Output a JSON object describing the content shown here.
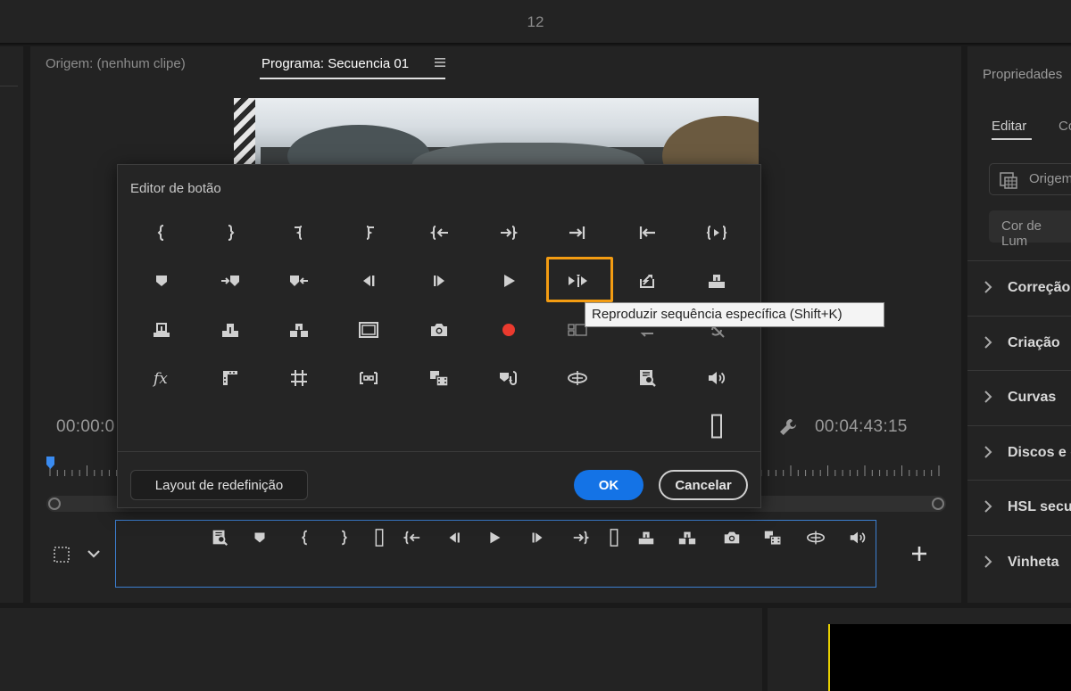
{
  "topbar": {
    "workspace_number": "12"
  },
  "program_monitor": {
    "source_tab": "Origem: (nenhum clipe)",
    "program_tab": "Programa: Secuencia 01",
    "timecode_left": "00:00:0",
    "timecode_right": "00:04:43:15"
  },
  "properties_panel": {
    "title": "Propriedades",
    "tabs": [
      "Editar",
      "Co"
    ],
    "origin_label": "Origem",
    "luma_label": "Cor de Lum",
    "sections": [
      "Correção",
      "Criação",
      "Curvas",
      "Discos e c",
      "HSL secu",
      "Vinheta"
    ]
  },
  "button_editor": {
    "title": "Editor de botão",
    "rows": [
      [
        "mark-in-icon",
        "mark-out-icon",
        "clear-in-icon",
        "clear-out-icon",
        "go-to-in-icon",
        "go-to-out-icon",
        "go-to-next-edit-icon",
        "go-to-previous-edit-icon",
        "play-in-to-out-icon"
      ],
      [
        "add-marker-icon",
        "go-to-next-marker-icon",
        "go-to-previous-marker-icon",
        "step-back-icon",
        "step-forward-icon",
        "play-icon",
        "play-around-icon",
        "export-frame-alt-icon",
        "lift-icon"
      ],
      [
        "overwrite-icon",
        "insert-icon",
        "extract-icon",
        "safe-margins-icon",
        "export-frame-icon",
        "record-icon",
        "multi-camera-icon",
        "loop-icon",
        "comparison-view-icon"
      ],
      [
        "fx-icon",
        "proxy-icon",
        "grid-icon",
        "trim-icon",
        "insert-clip-icon",
        "replace-icon",
        "vr-icon",
        "zoom-search-icon",
        "volume-icon"
      ]
    ],
    "extra_item": "spacer-icon",
    "tooltip": "Reproduzir sequência específica (Shift+K)",
    "reset_label": "Layout de redefinição",
    "ok_label": "OK",
    "cancel_label": "Cancelar"
  },
  "transport_bar": {
    "buttons": [
      "zoom-search-icon",
      "add-marker-icon",
      "mark-in-icon",
      "mark-out-icon",
      "spacer-icon",
      "go-to-in-icon",
      "step-back-icon",
      "play-icon",
      "step-forward-icon",
      "go-to-out-icon",
      "spacer-icon",
      "lift-icon",
      "extract-icon",
      "export-frame-icon",
      "insert-clip-icon",
      "vr-icon",
      "volume-icon"
    ]
  },
  "colors": {
    "accent": "#1473e6",
    "highlight": "#f39c12",
    "panel": "#232323",
    "background": "#1a1a1a"
  }
}
